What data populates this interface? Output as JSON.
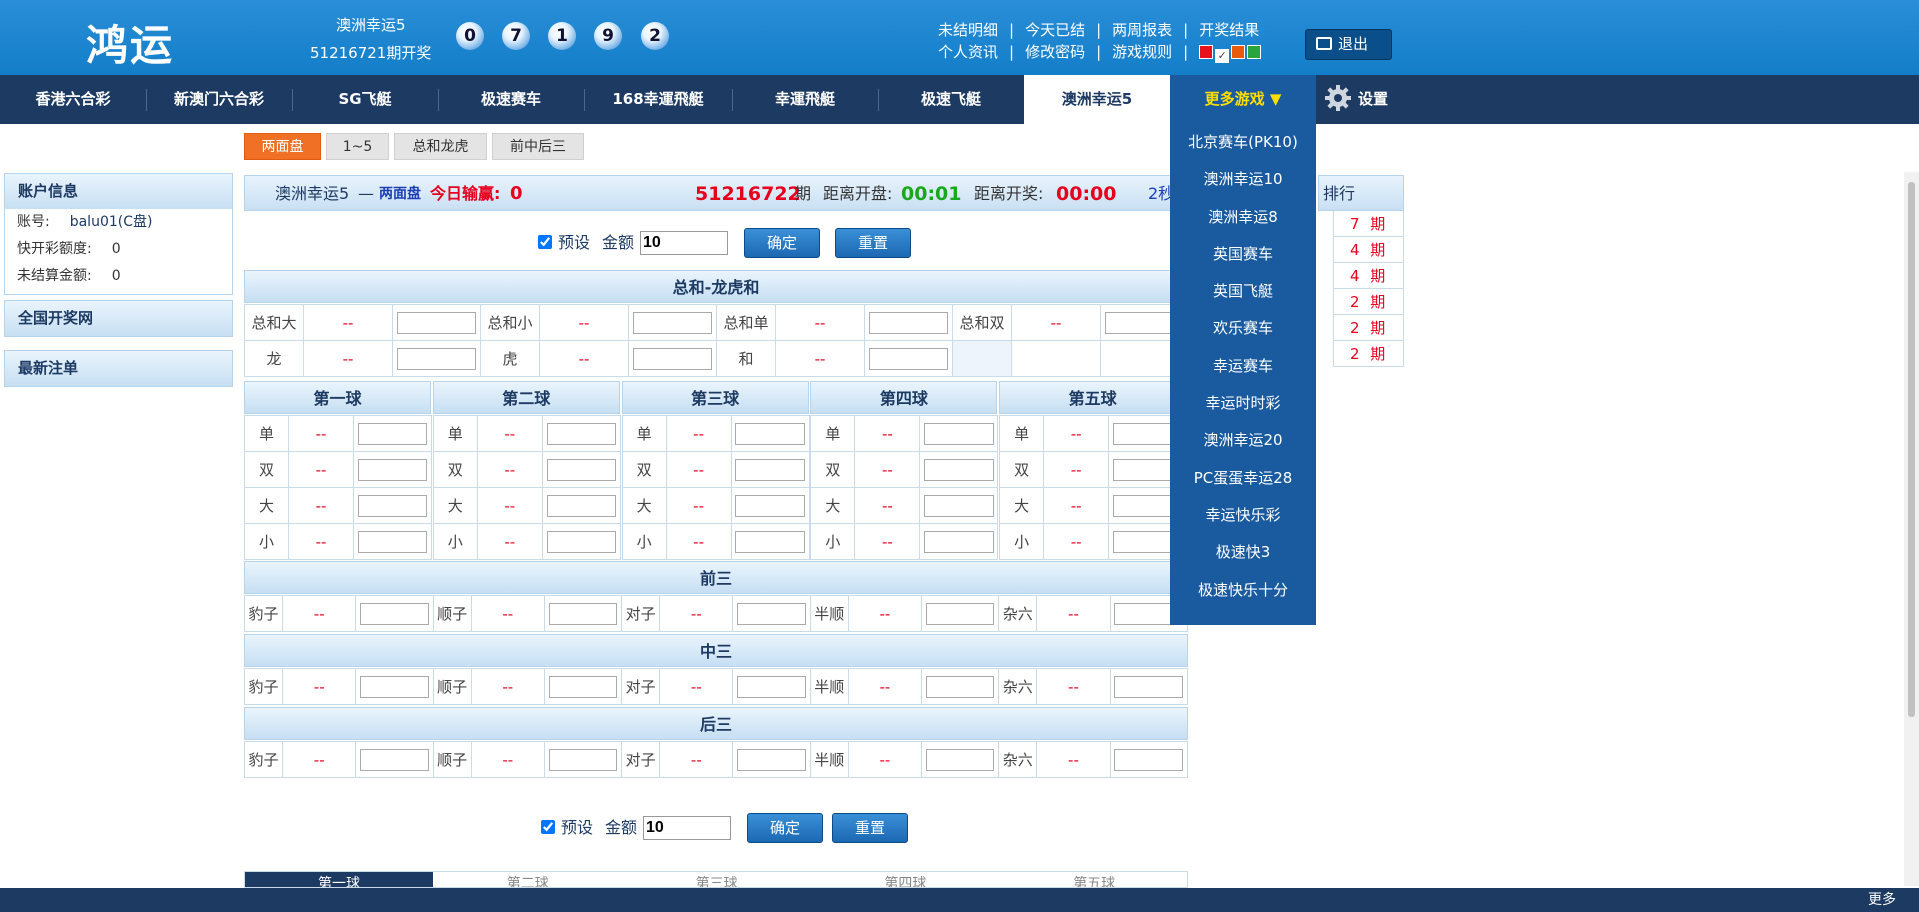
{
  "brand": "鸿运",
  "lottery": {
    "name": "澳洲幸运5",
    "issue_text": "51216721期开奖",
    "balls": [
      "0",
      "7",
      "1",
      "9",
      "2"
    ]
  },
  "header_links": {
    "row1": [
      "未结明细",
      "今天已结",
      "两周报表",
      "开奖结果"
    ],
    "row2": [
      "个人资讯",
      "修改密码",
      "游戏规则"
    ],
    "themes": [
      "#e8121c",
      "#ffffff",
      "#e85a0c",
      "#2aa43c"
    ]
  },
  "logout": "退出",
  "nav": [
    "香港六合彩",
    "新澳门六合彩",
    "SG飞艇",
    "极速赛车",
    "168幸運飛艇",
    "幸運飛艇",
    "极速飞艇",
    "澳洲幸运5"
  ],
  "more_games": "更多游戏 ▼",
  "settings": "设置",
  "dropdown": [
    "北京赛车(PK10)",
    "澳洲幸运10",
    "澳洲幸运8",
    "英国赛车",
    "英国飞艇",
    "欢乐赛车",
    "幸运赛车",
    "幸运时时彩",
    "澳洲幸运20",
    "PC蛋蛋幸运28",
    "幸运快乐彩",
    "极速快3",
    "极速快乐十分"
  ],
  "tabs": [
    "两面盘",
    "1~5",
    "总和龙虎",
    "前中后三"
  ],
  "sidebar": {
    "account_title": "账户信息",
    "account_label": "账号:",
    "account_value": "balu01(C盘)",
    "quota_label": "快开彩额度:",
    "quota_value": "0",
    "unsettled_label": "未结算金额:",
    "unsettled_value": "0",
    "national": "全国开奖网",
    "latest": "最新注单"
  },
  "infobar": {
    "game": "澳洲幸运5",
    "dash": "—",
    "mode": "两面盘",
    "today_label": "今日输赢:",
    "today_value": "0",
    "issue": "51216722",
    "issue_suffix": "期",
    "close_label": "距离开盘:",
    "close_value": "00:01",
    "draw_label": "距离开奖:",
    "draw_value": "00:00",
    "refresh": "2秒"
  },
  "rank": {
    "title": "排行",
    "items": [
      "7 期",
      "4 期",
      "4 期",
      "2 期",
      "2 期",
      "2 期"
    ]
  },
  "controls": {
    "preset": "预设",
    "amount_label": "金额",
    "amount": "10",
    "confirm": "确定",
    "reset": "重置"
  },
  "sections": {
    "sum": "总和-龙虎和",
    "front": "前三",
    "mid": "中三",
    "back": "后三"
  },
  "sum_row1": [
    "总和大",
    "总和小",
    "总和单",
    "总和双"
  ],
  "sum_row2": [
    "龙",
    "虎",
    "和"
  ],
  "balls": [
    "第一球",
    "第二球",
    "第三球",
    "第四球",
    "第五球"
  ],
  "ball_rows": [
    "单",
    "双",
    "大",
    "小"
  ],
  "three_items": [
    "豹子",
    "顺子",
    "对子",
    "半顺",
    "杂六"
  ],
  "odds": "--",
  "footer": "更多"
}
